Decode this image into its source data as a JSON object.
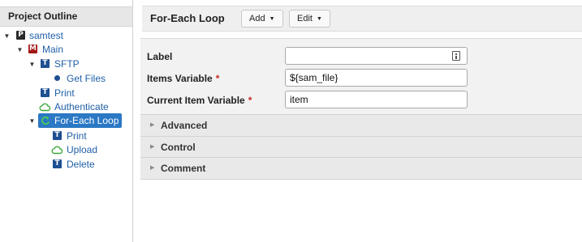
{
  "outline": {
    "header": "Project Outline",
    "items": [
      {
        "label": "samtest",
        "icon": "project-icon"
      },
      {
        "label": "Main",
        "icon": "module-icon"
      },
      {
        "label": "SFTP",
        "icon": "task-icon"
      },
      {
        "label": "Get Files",
        "icon": "bullet-icon"
      },
      {
        "label": "Print",
        "icon": "task-icon"
      },
      {
        "label": "Authenticate",
        "icon": "cloud-icon"
      },
      {
        "label": "For-Each Loop",
        "icon": "loop-icon",
        "selected": true
      },
      {
        "label": "Print",
        "icon": "task-icon"
      },
      {
        "label": "Upload",
        "icon": "cloud-icon"
      },
      {
        "label": "Delete",
        "icon": "task-icon"
      }
    ]
  },
  "editor": {
    "title": "For-Each Loop",
    "add_label": "Add",
    "edit_label": "Edit",
    "fields": [
      {
        "label": "Label",
        "required": false,
        "value": ""
      },
      {
        "label": "Items Variable",
        "required": true,
        "value": "${sam_file}"
      },
      {
        "label": "Current Item Variable",
        "required": true,
        "value": "item"
      }
    ],
    "required_mark": "*",
    "sections": [
      "Advanced",
      "Control",
      "Comment"
    ]
  },
  "colors": {
    "selection": "#2b78c4",
    "link": "#1f5fa8",
    "required": "#c62828",
    "cloud": "#3aa83a"
  }
}
